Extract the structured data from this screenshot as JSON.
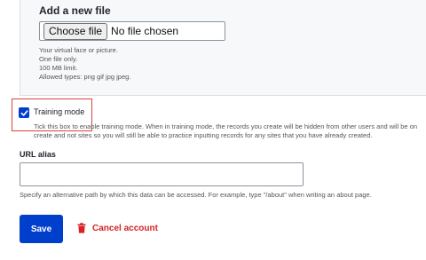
{
  "file_upload": {
    "title": "Add a new file",
    "choose_label": "Choose file",
    "no_file_text": "No file chosen",
    "help": [
      "Your virtual face or picture.",
      "One file only.",
      "100 MB limit.",
      "Allowed types: png gif jpg jpeg."
    ]
  },
  "training_mode": {
    "label": "Training mode",
    "checked": true,
    "description_line1": "Tick this box to enable training mode. When in training mode, the records you create will be hidden from other users and will be on",
    "description_line2": "create and not sites so you will still be able to practice inputting records for any sites that you have already created."
  },
  "url_alias": {
    "title": "URL alias",
    "value": "",
    "description": "Specify an alternative path by which this data can be accessed. For example, type \"/about\" when writing an about page."
  },
  "actions": {
    "save_label": "Save",
    "cancel_label": "Cancel account"
  },
  "colors": {
    "primary": "#003ecc",
    "danger": "#d72222",
    "highlight": "#d9443a"
  },
  "icons": {
    "checkbox": "check-icon",
    "cancel": "trash-icon"
  }
}
